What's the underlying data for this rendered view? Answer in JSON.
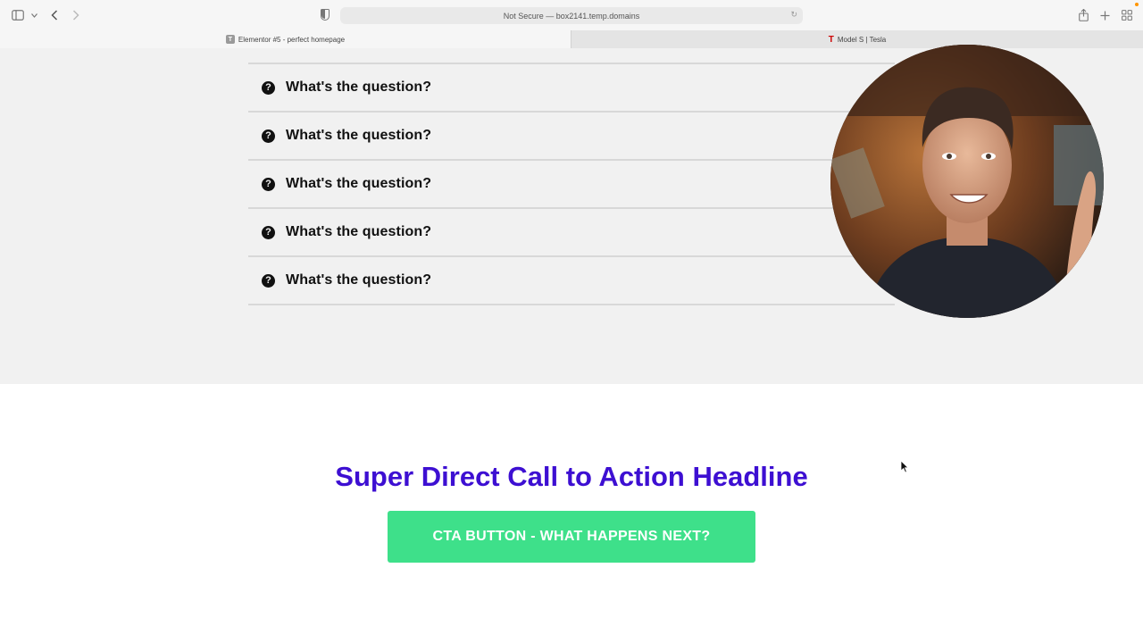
{
  "browser": {
    "url_text": "Not Secure — box2141.temp.domains",
    "tabs": [
      {
        "title": "Elementor #5 - perfect homepage",
        "favicon": "T"
      },
      {
        "title": "Model S | Tesla",
        "favicon": "tesla-logo"
      }
    ]
  },
  "faq": {
    "items": [
      {
        "question": "What's the question?"
      },
      {
        "question": "What's the question?"
      },
      {
        "question": "What's the question?"
      },
      {
        "question": "What's the question?"
      },
      {
        "question": "What's the question?"
      }
    ],
    "icon_glyph": "?"
  },
  "cta": {
    "headline": "Super Direct Call to Action Headline",
    "button_label": "CTA BUTTON - WHAT HAPPENS NEXT?"
  },
  "colors": {
    "headline": "#3d0fd2",
    "button": "#3ee08a",
    "faq_background": "#f1f1f1"
  }
}
